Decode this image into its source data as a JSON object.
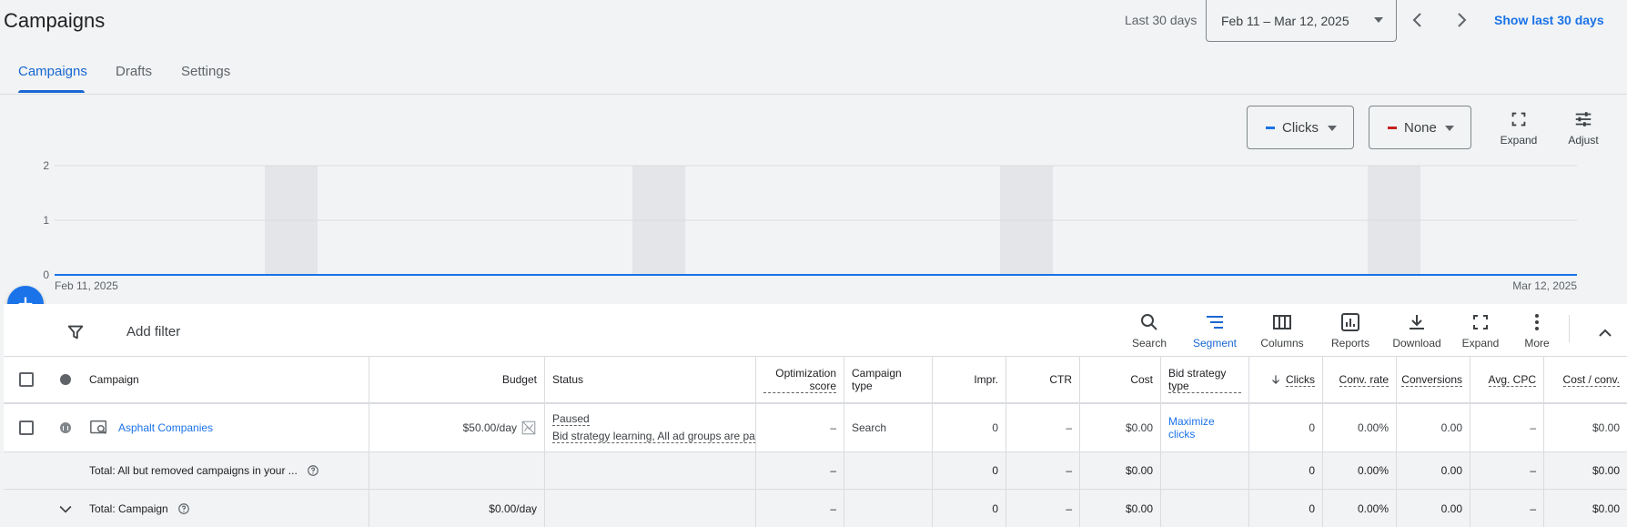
{
  "header": {
    "title": "Campaigns",
    "date_label": "Last 30 days",
    "date_range": "Feb 11 – Mar 12, 2025",
    "show_last": "Show last 30 days"
  },
  "tabs": [
    {
      "label": "Campaigns",
      "active": true
    },
    {
      "label": "Drafts",
      "active": false
    },
    {
      "label": "Settings",
      "active": false
    }
  ],
  "chart_controls": {
    "metric1": {
      "label": "Clicks",
      "color": "#1a73e8"
    },
    "metric2": {
      "label": "None",
      "color": "#c5221f"
    },
    "expand_label": "Expand",
    "adjust_label": "Adjust"
  },
  "chart_data": {
    "type": "line",
    "x_start_label": "Feb 11, 2025",
    "x_end_label": "Mar 12, 2025",
    "y_ticks": [
      "2",
      "1",
      "0"
    ],
    "ylim": [
      0,
      2
    ],
    "series": [
      {
        "values": [
          0,
          0
        ]
      }
    ],
    "line_color": "#1a73e8"
  },
  "toolbar": {
    "add_filter": "Add filter",
    "search": "Search",
    "segment": "Segment",
    "columns": "Columns",
    "reports": "Reports",
    "download": "Download",
    "expand": "Expand",
    "more": "More"
  },
  "table": {
    "columns": {
      "campaign": "Campaign",
      "budget": "Budget",
      "status": "Status",
      "opt_score": "Optimization score",
      "campaign_type": "Campaign type",
      "impr": "Impr.",
      "ctr": "CTR",
      "cost": "Cost",
      "bid_strategy": "Bid strategy type",
      "clicks": "Clicks",
      "conv_rate": "Conv. rate",
      "conversions": "Conversions",
      "avg_cpc": "Avg. CPC",
      "cost_conv": "Cost / conv."
    },
    "row": {
      "campaign": "Asphalt Companies",
      "budget": "$50.00/day",
      "status": "Paused",
      "status_detail": "Bid strategy learning, All ad groups are paused",
      "opt_score": "–",
      "campaign_type": "Search",
      "impr": "0",
      "ctr": "–",
      "cost": "$0.00",
      "bid_strategy": "Maximize clicks",
      "clicks": "0",
      "conv_rate": "0.00%",
      "conversions": "0.00",
      "avg_cpc": "–",
      "cost_conv": "$0.00"
    },
    "total_all": {
      "label": "Total: All but removed campaigns in your ...",
      "opt_score": "–",
      "impr": "0",
      "ctr": "–",
      "cost": "$0.00",
      "clicks": "0",
      "conv_rate": "0.00%",
      "conversions": "0.00",
      "avg_cpc": "–",
      "cost_conv": "$0.00"
    },
    "total_campaign": {
      "label": "Total: Campaign",
      "budget": "$0.00/day",
      "opt_score": "–",
      "impr": "0",
      "ctr": "–",
      "cost": "$0.00",
      "clicks": "0",
      "conv_rate": "0.00%",
      "conversions": "0.00",
      "avg_cpc": "–",
      "cost_conv": "$0.00"
    }
  }
}
